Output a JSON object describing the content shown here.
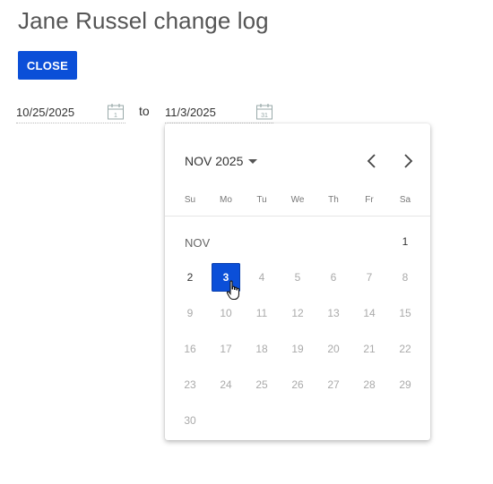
{
  "page": {
    "title": "Jane Russel change log"
  },
  "actions": {
    "close_label": "CLOSE"
  },
  "range": {
    "from_value": "10/25/2025",
    "from_icon": "calendar-icon",
    "from_icon_digit": "1",
    "to_label": "to",
    "to_value": "11/3/2025",
    "to_icon": "calendar-icon",
    "to_icon_digit": "31"
  },
  "calendar": {
    "month_select_label": "NOV 2025",
    "prev_icon": "chevron-left-icon",
    "next_icon": "chevron-right-icon",
    "weekdays": [
      "Su",
      "Mo",
      "Tu",
      "We",
      "Th",
      "Fr",
      "Sa"
    ],
    "month_short": "NOV",
    "days": [
      "1",
      "2",
      "3",
      "4",
      "5",
      "6",
      "7",
      "8",
      "9",
      "10",
      "11",
      "12",
      "13",
      "14",
      "15",
      "16",
      "17",
      "18",
      "19",
      "20",
      "21",
      "22",
      "23",
      "24",
      "25",
      "26",
      "27",
      "28",
      "29",
      "30"
    ],
    "selected_day": "3",
    "enabled_days": [
      "1",
      "2",
      "3"
    ],
    "accent_color": "#0b4fd8"
  }
}
